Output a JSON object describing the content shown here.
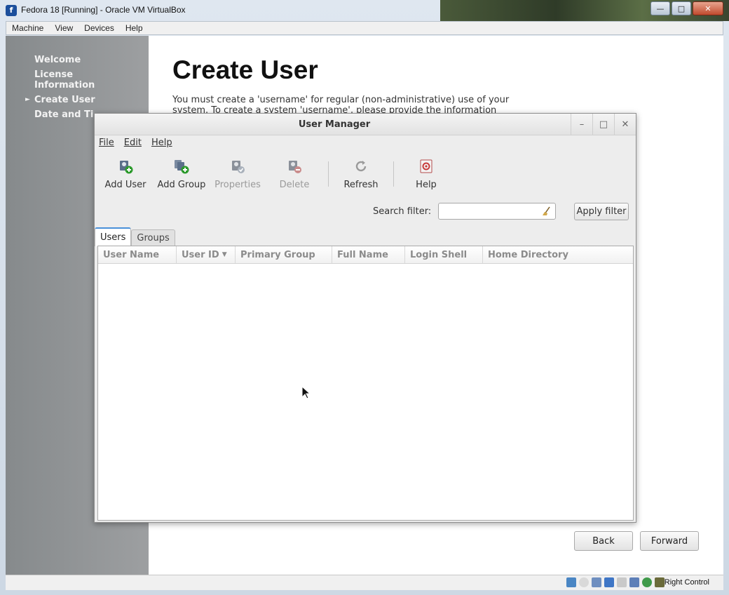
{
  "host_window": {
    "title": "Fedora 18 [Running] - Oracle VM VirtualBox",
    "menu": [
      "Machine",
      "View",
      "Devices",
      "Help"
    ]
  },
  "installer": {
    "steps": [
      {
        "label": "Welcome"
      },
      {
        "label": "License Information"
      },
      {
        "label": "Create User",
        "current": true
      },
      {
        "label": "Date and Ti"
      }
    ],
    "page_title": "Create User",
    "description": "You must create a 'username' for regular (non-administrative) use of your system.  To create a system 'username', please provide the information",
    "back_label": "Back",
    "forward_label": "Forward"
  },
  "user_manager": {
    "title": "User Manager",
    "menu": [
      "File",
      "Edit",
      "Help"
    ],
    "toolbar": [
      {
        "label": "Add User",
        "icon": "add-user-icon",
        "enabled": true
      },
      {
        "label": "Add Group",
        "icon": "add-group-icon",
        "enabled": true
      },
      {
        "label": "Properties",
        "icon": "properties-icon",
        "enabled": false
      },
      {
        "label": "Delete",
        "icon": "delete-icon",
        "enabled": false
      },
      {
        "label": "Refresh",
        "icon": "refresh-icon",
        "enabled": true
      },
      {
        "label": "Help",
        "icon": "help-icon",
        "enabled": true
      }
    ],
    "search_label": "Search filter:",
    "search_value": "",
    "apply_label": "Apply filter",
    "tabs": [
      {
        "label": "Users",
        "active": true
      },
      {
        "label": "Groups",
        "active": false
      }
    ],
    "columns": [
      "User Name",
      "User ID",
      "Primary Group",
      "Full Name",
      "Login Shell",
      "Home Directory"
    ],
    "sorted_column": "User ID",
    "rows": []
  },
  "status_bar": {
    "host_key": "Right Control"
  },
  "colors": {
    "tab_accent": "#4a90d9",
    "sidebar": "#9d9fa1"
  }
}
